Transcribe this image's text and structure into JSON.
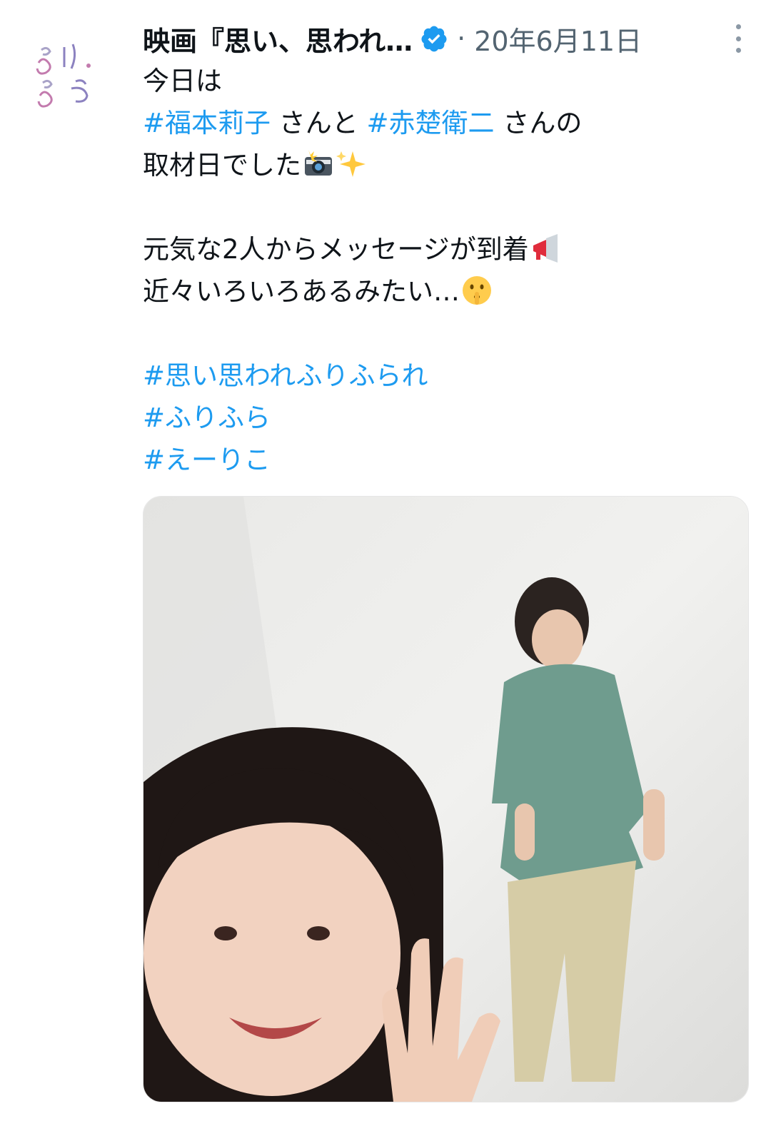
{
  "tweet": {
    "author_name": "映画『思い、思われ…",
    "separator": "·",
    "date": "20年6月11日",
    "avatar_icon": "furifura-logo",
    "avatar_text": "ふり、ふら",
    "verified_icon": "verified-badge-icon",
    "more_icon": "more-vertical-icon",
    "lines": {
      "l1": "今日は",
      "l2_tag1": "#福本莉子",
      "l2_text1": " さんと ",
      "l2_tag2": "#赤楚衛二",
      "l2_text2": " さんの",
      "l3": "取材日でした",
      "l5": "元気な2人からメッセージが到着",
      "l6": "近々いろいろあるみたい…",
      "tag_a": "#思い思われふりふられ",
      "tag_b": "#ふりふら",
      "tag_c": "#えーりこ"
    },
    "emojis": [
      "camera-flash-emoji",
      "sparkles-emoji",
      "megaphone-emoji",
      "shushing-face-emoji"
    ],
    "media": {
      "type": "video-thumbnail",
      "subject": "two-people-in-white-studio"
    }
  },
  "colors": {
    "hashtag": "#1d9bf0",
    "text": "#0f1419",
    "meta": "#536471",
    "verified": "#1d9bf0"
  }
}
